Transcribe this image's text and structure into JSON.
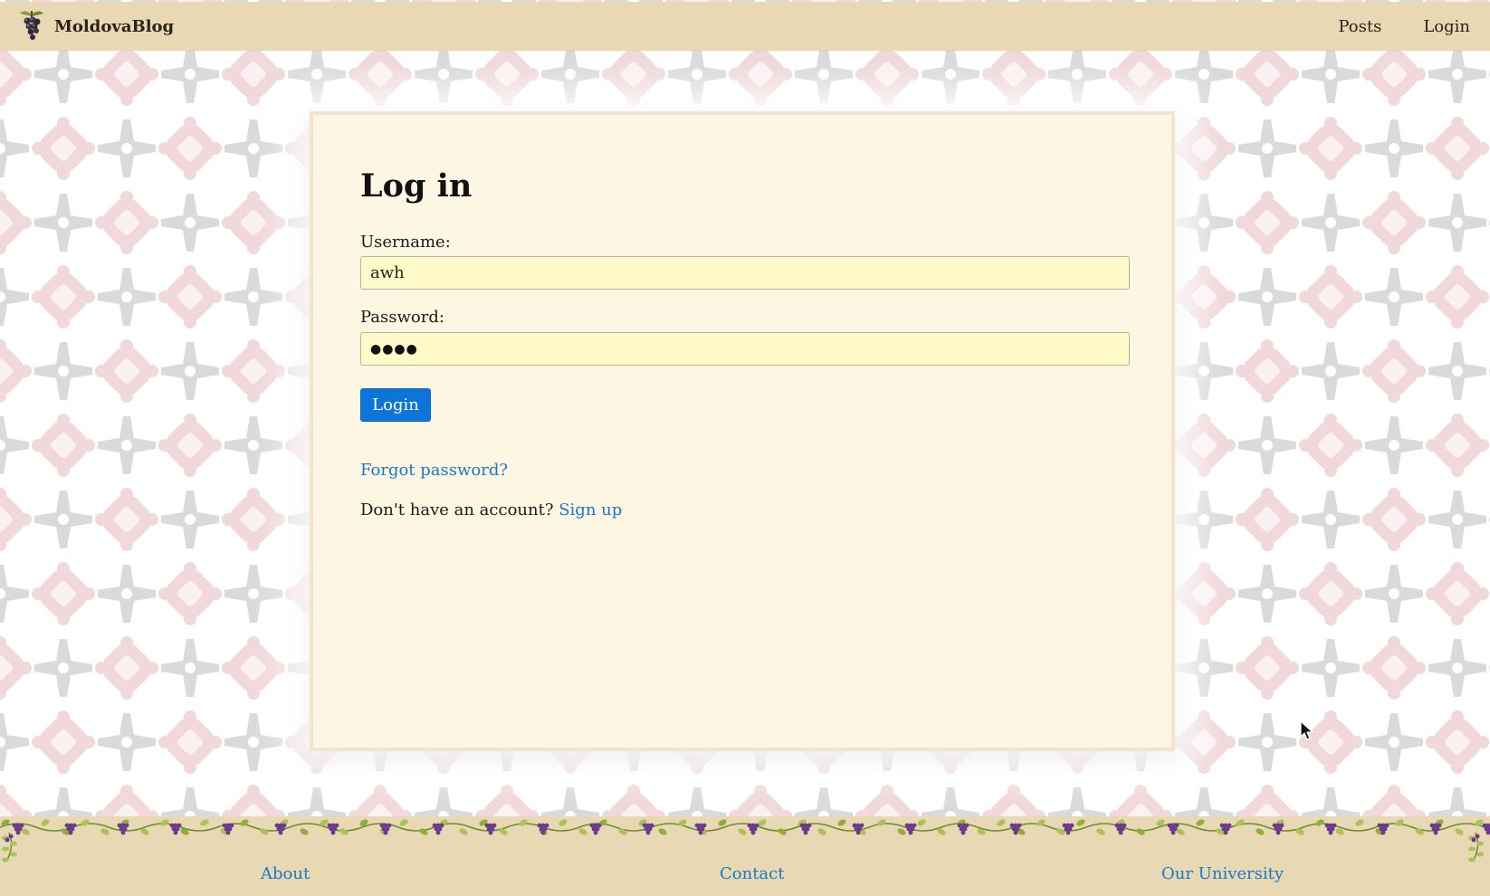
{
  "navbar": {
    "brand": "MoldovaBlog",
    "logo_icon": "grape-bunch-logo-icon",
    "links": [
      "Posts",
      "Login"
    ]
  },
  "form": {
    "title": "Log in",
    "username_label": "Username:",
    "username_value": "awh",
    "password_label": "Password:",
    "password_masked": "●●●●",
    "submit_label": "Login",
    "forgot_password": "Forgot password?",
    "signup_prompt": "Don't have an account?",
    "signup_link": "Sign up"
  },
  "footer": {
    "links": [
      "About",
      "Contact",
      "Our University"
    ]
  },
  "colors": {
    "navbar_bg": "#e8d9b4",
    "card_bg": "#fdf6e3",
    "input_bg": "#fffac8",
    "primary_button": "#0c76d8",
    "link": "#1779c9",
    "pattern_grey": "#d9d9d9",
    "pattern_pink": "#f0d6d9"
  }
}
